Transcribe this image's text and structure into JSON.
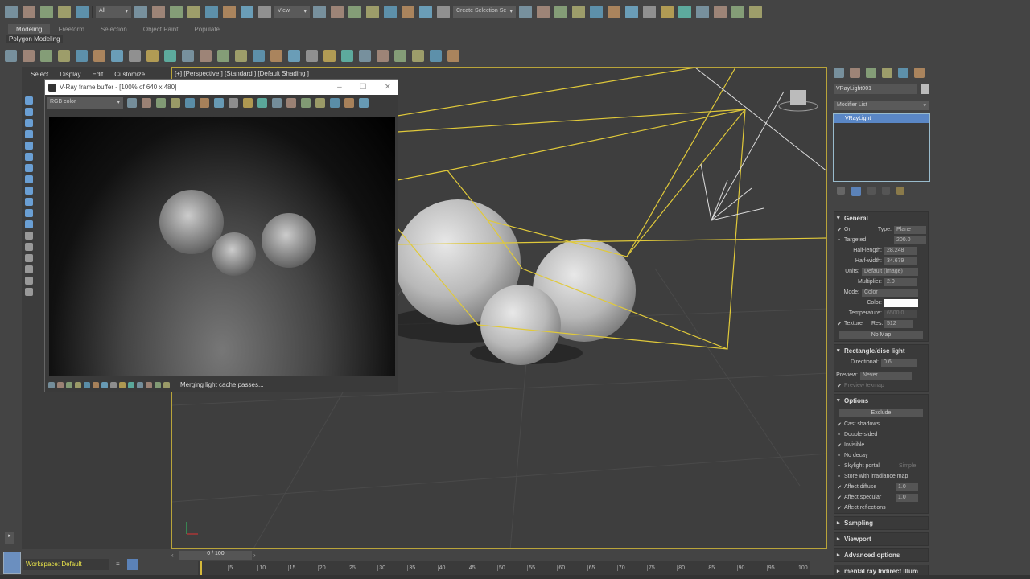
{
  "toolbar": {
    "filter": "All",
    "view": "View",
    "selection_set": "Create Selection Se",
    "icons": [
      "undo-icon",
      "redo-icon",
      "link-icon",
      "unlink-icon",
      "bind-space-warp-icon"
    ],
    "icons2": [
      "select-object-icon",
      "select-by-name-icon",
      "rect-selection-icon",
      "window-crossing-icon",
      "move-icon",
      "rotate-icon",
      "scale-icon",
      "ref-coord-icon"
    ],
    "icons3": [
      "pivot-icon",
      "snap-move-icon",
      "keyboard-shortcut-icon",
      "snap-3d-icon",
      "angle-snap-icon",
      "percent-snap-icon",
      "spinner-snap-icon",
      "edit-named-selection-icon"
    ],
    "icons4": [
      "mirror-icon",
      "align-icon",
      "scene-explorer-icon",
      "layer-explorer-icon",
      "ribbon-icon",
      "curve-editor-icon",
      "dope-sheet-icon",
      "schematic-view-icon",
      "material-editor-icon",
      "render-setup-icon",
      "rendered-frame-icon",
      "render-icon",
      "render-iterative-icon",
      "grid-icon"
    ]
  },
  "ribbon": {
    "tabs": [
      "Modeling",
      "Freeform",
      "Selection",
      "Object Paint",
      "Populate"
    ],
    "active": "Modeling",
    "panel": "Polygon Modeling"
  },
  "toolbar2": {
    "icons": [
      "teapot-icon",
      "render-frame-icon",
      "render-setup-icon",
      "render-message-icon",
      "vray-light-lister-icon",
      "camera-icon",
      "dome-icon",
      "vray-frame-buffer-icon",
      "plane-light-icon",
      "sphere-light-icon",
      "mesh-light-icon",
      "teapot-icon",
      "cone-light-icon",
      "sun-icon",
      "sky-icon",
      "fur-icon",
      "particles-icon",
      "proxy-icon",
      "scatter-icon",
      "grass-icon",
      "hair-icon",
      "sphere-icon",
      "ball-icon",
      "blue-sphere-icon",
      "material-icon",
      "help-icon"
    ]
  },
  "scene_menu": [
    "Select",
    "Display",
    "Edit",
    "Customize"
  ],
  "viewport": {
    "label": "[+] [Perspective ] [Standard ] [Default Shading ]"
  },
  "vfb": {
    "title": "V-Ray frame buffer - [100% of 640 x 480]",
    "channel": "RGB color",
    "status": "Merging light cache passes...",
    "icons": [
      "color-balance-icon",
      "red-channel-icon",
      "green-channel-icon",
      "blue-channel-icon",
      "white-sphere-icon",
      "gray-sphere-icon",
      "save-icon",
      "open-icon",
      "clipboard-icon",
      "clear-icon",
      "region-icon",
      "link-icon",
      "teapot-icon",
      "history-icon",
      "refresh-icon",
      "stop-icon",
      "render-icon"
    ]
  },
  "command_panel": {
    "tabs": [
      "create-icon",
      "modify-icon",
      "hierarchy-icon",
      "motion-icon",
      "display-icon",
      "utilities-icon"
    ],
    "object_name": "VRayLight001",
    "modifier_list": "Modifier List",
    "stack": [
      "VRayLight"
    ]
  },
  "general": {
    "title": "General",
    "on": "On",
    "type_label": "Type:",
    "type": "Plane",
    "targeted": "Targeted",
    "targeted_value": "200.0",
    "half_length_label": "Half-length:",
    "half_length": "28.248",
    "half_width_label": "Half-width:",
    "half_width": "34.679",
    "units_label": "Units:",
    "units": "Default (image)",
    "multiplier_label": "Multiplier:",
    "multiplier": "2.0",
    "mode_label": "Mode:",
    "mode": "Color",
    "color_label": "Color:",
    "color": "#ffffff",
    "temperature_label": "Temperature:",
    "temperature": "6500.0",
    "texture": "Texture",
    "res_label": "Res:",
    "res": "512",
    "no_map": "No Map"
  },
  "rect": {
    "title": "Rectangle/disc light",
    "directional_label": "Directional:",
    "directional": "0.6",
    "preview_label": "Preview:",
    "preview": "Never",
    "preview_texmap": "Preview texmap"
  },
  "options": {
    "title": "Options",
    "exclude": "Exclude",
    "items": [
      {
        "label": "Cast shadows",
        "checked": true
      },
      {
        "label": "Double-sided",
        "checked": false
      },
      {
        "label": "Invisible",
        "checked": true
      },
      {
        "label": "No decay",
        "checked": false
      },
      {
        "label": "Skylight portal",
        "checked": false,
        "extra": "Simple"
      },
      {
        "label": "Store with irradiance map",
        "checked": false
      },
      {
        "label": "Affect diffuse",
        "checked": true,
        "value": "1.0"
      },
      {
        "label": "Affect specular",
        "checked": true,
        "value": "1.0"
      },
      {
        "label": "Affect reflections",
        "checked": true
      }
    ]
  },
  "collapsed": [
    "Sampling",
    "Viewport",
    "Advanced options",
    "mental ray Indirect Illum"
  ],
  "timeline": {
    "frame": "0 / 100",
    "ticks": [
      "5",
      "10",
      "15",
      "20",
      "25",
      "30",
      "35",
      "40",
      "45",
      "50",
      "55",
      "60",
      "65",
      "70",
      "75",
      "80",
      "85",
      "90",
      "95",
      "100"
    ]
  },
  "workspace": "Workspace: Default"
}
